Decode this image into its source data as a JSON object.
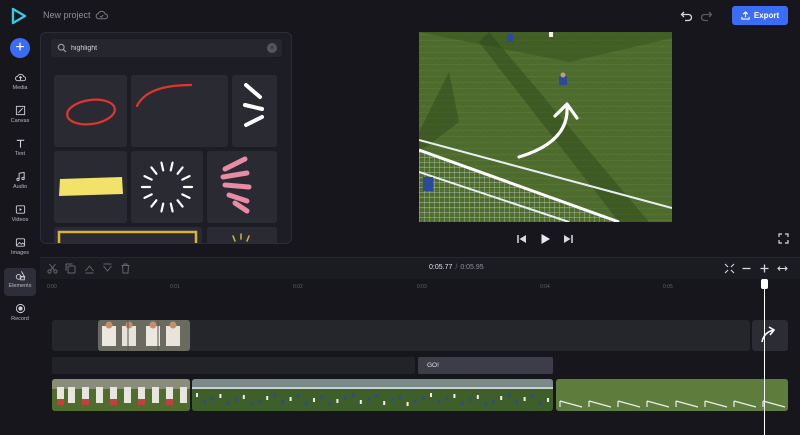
{
  "header": {
    "project_title": "New project",
    "export_label": "Export"
  },
  "sidebar": {
    "items": [
      {
        "label": "Media",
        "icon": "upload-cloud-icon"
      },
      {
        "label": "Canvas",
        "icon": "canvas-icon"
      },
      {
        "label": "Text",
        "icon": "text-icon"
      },
      {
        "label": "Audio",
        "icon": "music-icon"
      },
      {
        "label": "Videos",
        "icon": "video-icon"
      },
      {
        "label": "Images",
        "icon": "image-icon"
      },
      {
        "label": "Elements",
        "icon": "elements-icon",
        "active": true
      },
      {
        "label": "Record",
        "icon": "record-icon"
      }
    ]
  },
  "elements_panel": {
    "search_value": "highlight"
  },
  "timeline": {
    "current_time": "0:05.77",
    "total_time": "0:05.95",
    "ruler_ticks": [
      "0:00",
      "0:01",
      "0:02",
      "0:03",
      "0:04",
      "0:05"
    ],
    "text_clip_label": "GO!"
  },
  "colors": {
    "accent": "#3b6cf5",
    "highlight_yellow": "#f2e26a",
    "highlight_red": "#e0352f",
    "highlight_pink": "#e88ba4"
  }
}
